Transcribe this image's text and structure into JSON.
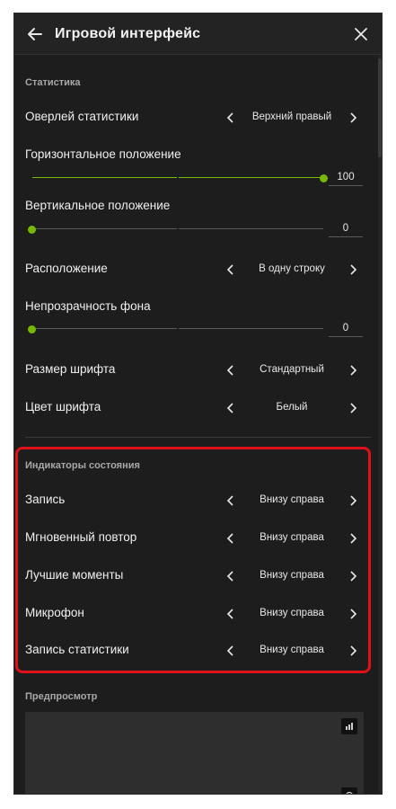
{
  "header": {
    "title": "Игровой интерфейс",
    "back_icon": "arrow-left-icon",
    "close_icon": "close-icon"
  },
  "stats": {
    "section_title": "Статистика",
    "overlay": {
      "label": "Оверлей статистики",
      "value": "Верхний правый"
    },
    "horizontal": {
      "label": "Горизонтальное положение",
      "value": "100",
      "fraction": 1.0
    },
    "vertical": {
      "label": "Вертикальное положение",
      "value": "0",
      "fraction": 0.0
    },
    "layout": {
      "label": "Расположение",
      "value": "В одну строку"
    },
    "opacity": {
      "label": "Непрозрачность фона",
      "value": "0",
      "fraction": 0.0
    },
    "font_size": {
      "label": "Размер шрифта",
      "value": "Стандартный"
    },
    "font_color": {
      "label": "Цвет шрифта",
      "value": "Белый"
    }
  },
  "indicators": {
    "section_title": "Индикаторы состояния",
    "items": [
      {
        "label": "Запись",
        "value": "Внизу справа"
      },
      {
        "label": "Мгновенный повтор",
        "value": "Внизу справа"
      },
      {
        "label": "Лучшие моменты",
        "value": "Внизу справа"
      },
      {
        "label": "Микрофон",
        "value": "Внизу справа"
      },
      {
        "label": "Запись статистики",
        "value": "Внизу справа"
      }
    ]
  },
  "preview": {
    "section_title": "Предпросмотр"
  },
  "colors": {
    "accent": "#76b900",
    "highlight": "#e0101a",
    "panel_bg": "#1d1d1d"
  }
}
